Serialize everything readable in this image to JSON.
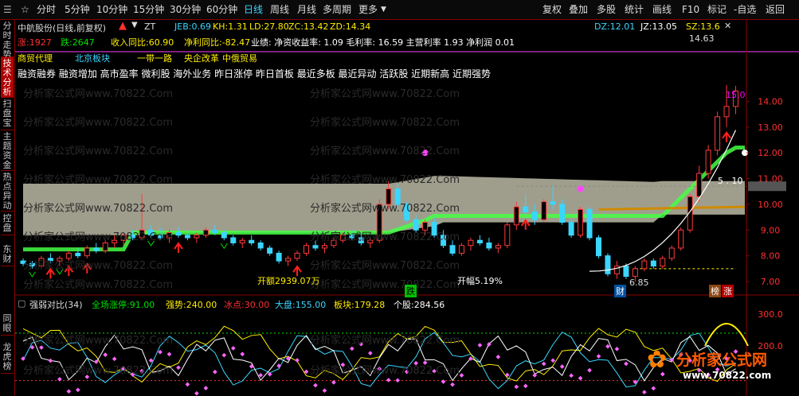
{
  "toolbar": {
    "nav": [
      "分时",
      "5分钟",
      "10分钟",
      "15分钟",
      "30分钟",
      "60分钟",
      "日线",
      "周线",
      "月线",
      "多周期",
      "更多"
    ],
    "active": "日线",
    "right": [
      "复权",
      "叠加",
      "多股",
      "统计",
      "画线",
      "F10",
      "标记",
      "-自选",
      "返回"
    ]
  },
  "sidebar": [
    "分时走势",
    "技术分析",
    "扫盘宝",
    "主题资金",
    "热点异动",
    "控盘",
    "东财",
    "同眼",
    "龙虎榜"
  ],
  "sidebar_active": "技术分析",
  "header": {
    "stock": "中航股份(日线,前复权)",
    "zt": "ZT",
    "indicators": [
      {
        "label": "JEB:",
        "value": "0.69",
        "color": "#3ad6ff"
      },
      {
        "label": "KH:",
        "value": "1.31",
        "color": "#ffee00"
      },
      {
        "label": "LD:",
        "value": "27.80",
        "color": "#ffee00"
      },
      {
        "label": "ZC:",
        "value": "13.42",
        "color": "#ffee00"
      },
      {
        "label": "ZD:",
        "value": "14.34",
        "color": "#ffee00"
      }
    ],
    "right": [
      {
        "label": "DZ:",
        "value": "12.01",
        "color": "#3ad6ff"
      },
      {
        "label": "JZ:",
        "value": "13.05",
        "color": "#ffffff"
      },
      {
        "label": "SZ:",
        "value": "13.6",
        "color": "#ffee00"
      }
    ],
    "row2": {
      "up": "涨:1927",
      "down": "跌:2647",
      "income": "收入同比:60.90",
      "profit": "净利同比:-82.47",
      "business": "业绩: 净资收益率: 1.09 毛利率: 16.59 主营利率 1.93 净利润 0.01"
    },
    "tags": [
      "商贸代理",
      "北京板块",
      "一带一路",
      "央企改革",
      "中俄贸易"
    ],
    "concepts": "融资融券 融资增加 高市盈率 微利股 海外业务 昨日涨停 昨日首板 最近多板 最近异动 活跃股 近期新高 近期强势"
  },
  "watermark": "分析家公式网www.70822.Com",
  "annotations": {
    "amount": "开额2939.07万",
    "amplitude": "开幅5.19%",
    "die": "跌",
    "low": "6.85",
    "high": "14.63",
    "cai": "财",
    "bang": "榜",
    "zhang": "涨",
    "level15": "15.0",
    "level10": "5 . 10"
  },
  "sub_panel": {
    "title": "强弱对比(34)",
    "values": [
      {
        "label": "全场涨停:",
        "value": "91.00",
        "color": "#00e000"
      },
      {
        "label": "强势:",
        "value": "240.00",
        "color": "#ffee00"
      },
      {
        "label": "冰点:",
        "value": "30.00",
        "color": "#ff3030"
      },
      {
        "label": "大盘:",
        "value": "155.00",
        "color": "#3ad6ff"
      },
      {
        "label": "板块:",
        "value": "179.28",
        "color": "#ffee00"
      },
      {
        "label": "个股:",
        "value": "284.56",
        "color": "#ffffff"
      }
    ],
    "yticks": [
      "300.0",
      "200.0"
    ]
  },
  "logo": {
    "text": "分析家公式网",
    "url": "www.70822.com"
  },
  "chart_data": {
    "type": "candlestick",
    "ylim": [
      6.6,
      15.0
    ],
    "yticks": [
      7.0,
      8.0,
      9.0,
      10.0,
      11.0,
      12.0,
      13.0,
      14.0
    ],
    "candles": [
      [
        7.8,
        7.9,
        7.6,
        7.7
      ],
      [
        7.7,
        7.8,
        7.5,
        7.6
      ],
      [
        7.6,
        8.0,
        7.5,
        7.9
      ],
      [
        7.9,
        8.1,
        7.7,
        7.8
      ],
      [
        7.8,
        8.0,
        7.6,
        7.9
      ],
      [
        7.9,
        8.2,
        7.8,
        8.1
      ],
      [
        8.1,
        8.3,
        7.9,
        8.0
      ],
      [
        8.0,
        8.4,
        7.9,
        8.3
      ],
      [
        8.3,
        8.5,
        8.1,
        8.2
      ],
      [
        8.2,
        8.6,
        8.1,
        8.5
      ],
      [
        8.5,
        8.8,
        8.3,
        8.6
      ],
      [
        8.6,
        8.9,
        8.4,
        8.8
      ],
      [
        8.8,
        9.0,
        8.6,
        8.7
      ],
      [
        8.7,
        10.4,
        8.6,
        9.0
      ],
      [
        9.0,
        9.2,
        8.7,
        8.8
      ],
      [
        8.8,
        9.1,
        8.6,
        8.7
      ],
      [
        8.7,
        9.0,
        8.5,
        8.9
      ],
      [
        8.9,
        9.1,
        8.7,
        8.8
      ],
      [
        8.8,
        9.0,
        8.6,
        8.7
      ],
      [
        8.7,
        8.9,
        8.5,
        8.8
      ],
      [
        8.8,
        9.1,
        8.7,
        9.0
      ],
      [
        9.0,
        9.2,
        8.8,
        8.9
      ],
      [
        8.9,
        9.0,
        8.6,
        8.7
      ],
      [
        8.7,
        8.8,
        8.4,
        8.5
      ],
      [
        8.5,
        8.7,
        8.3,
        8.6
      ],
      [
        8.6,
        8.8,
        8.4,
        8.5
      ],
      [
        8.5,
        8.6,
        8.2,
        8.3
      ],
      [
        8.3,
        8.4,
        8.0,
        8.1
      ],
      [
        8.1,
        8.2,
        7.7,
        7.8
      ],
      [
        7.8,
        8.0,
        7.6,
        7.9
      ],
      [
        7.9,
        8.2,
        7.8,
        8.1
      ],
      [
        8.1,
        8.5,
        8.0,
        8.4
      ],
      [
        8.4,
        8.6,
        8.2,
        8.3
      ],
      [
        8.3,
        8.5,
        8.1,
        8.4
      ],
      [
        8.4,
        8.7,
        8.3,
        8.6
      ],
      [
        8.6,
        8.9,
        8.5,
        8.8
      ],
      [
        8.8,
        9.0,
        8.6,
        8.7
      ],
      [
        8.7,
        8.9,
        8.4,
        8.5
      ],
      [
        8.5,
        8.7,
        8.3,
        8.6
      ],
      [
        8.6,
        10.2,
        8.5,
        10.0
      ],
      [
        10.0,
        10.9,
        9.8,
        10.6
      ],
      [
        10.6,
        10.8,
        9.9,
        10.0
      ],
      [
        10.0,
        10.1,
        9.3,
        9.4
      ],
      [
        9.4,
        9.6,
        8.9,
        9.0
      ],
      [
        9.0,
        9.4,
        8.8,
        9.3
      ],
      [
        9.3,
        9.5,
        8.7,
        8.8
      ],
      [
        8.8,
        9.0,
        8.3,
        8.4
      ],
      [
        8.4,
        8.6,
        8.0,
        8.1
      ],
      [
        8.1,
        8.5,
        8.0,
        8.4
      ],
      [
        8.4,
        8.7,
        8.2,
        8.6
      ],
      [
        8.6,
        8.8,
        8.4,
        8.5
      ],
      [
        8.5,
        8.7,
        8.2,
        8.3
      ],
      [
        8.3,
        8.5,
        8.1,
        8.4
      ],
      [
        8.4,
        9.3,
        8.3,
        9.2
      ],
      [
        9.2,
        10.1,
        9.0,
        9.9
      ],
      [
        9.9,
        10.4,
        9.6,
        9.7
      ],
      [
        9.7,
        10.0,
        9.2,
        9.4
      ],
      [
        9.4,
        10.2,
        9.3,
        10.1
      ],
      [
        10.1,
        10.7,
        9.8,
        10.0
      ],
      [
        10.0,
        10.2,
        9.2,
        9.3
      ],
      [
        9.3,
        9.4,
        8.7,
        8.8
      ],
      [
        8.8,
        9.9,
        8.7,
        9.8
      ],
      [
        9.8,
        9.9,
        8.6,
        8.7
      ],
      [
        8.7,
        8.8,
        7.9,
        8.0
      ],
      [
        8.0,
        8.1,
        7.2,
        7.3
      ],
      [
        7.3,
        7.8,
        7.1,
        7.6
      ],
      [
        7.6,
        7.7,
        7.1,
        7.2
      ],
      [
        7.2,
        7.6,
        7.0,
        7.5
      ],
      [
        7.5,
        7.9,
        7.4,
        7.8
      ],
      [
        7.8,
        7.9,
        7.5,
        7.6
      ],
      [
        7.6,
        8.0,
        7.5,
        7.9
      ],
      [
        7.9,
        8.4,
        7.8,
        8.3
      ],
      [
        8.3,
        9.1,
        8.2,
        9.0
      ],
      [
        9.0,
        10.4,
        8.9,
        10.3
      ],
      [
        10.3,
        11.5,
        10.1,
        11.2
      ],
      [
        11.2,
        12.3,
        11.0,
        12.1
      ],
      [
        12.1,
        13.6,
        11.9,
        13.4
      ],
      [
        13.4,
        14.63,
        13.0,
        13.8
      ],
      [
        13.8,
        14.6,
        13.5,
        14.4
      ]
    ],
    "series": [
      {
        "name": "ZC",
        "color": "#3ad6ff"
      },
      {
        "name": "ZD",
        "color": "#ffee00"
      }
    ]
  }
}
